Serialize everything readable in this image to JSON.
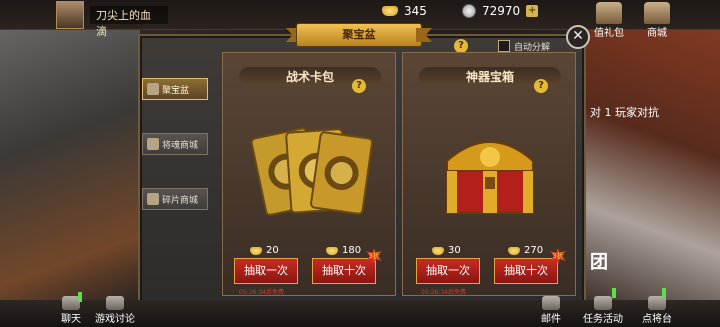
{
  "player": {
    "name": "刀尖上的血滴"
  },
  "resources": {
    "gold": "345",
    "silver": "72970",
    "gold_icon": "gold-ingot-icon",
    "silver_icon": "silver-coin-icon"
  },
  "top_menu": [
    {
      "label": "值礼包",
      "icon": "gift-icon"
    },
    {
      "label": "商城",
      "icon": "shop-icon"
    }
  ],
  "panel": {
    "title": "聚宝盆",
    "auto_decompose_label": "自动分解",
    "close_icon": "close-icon"
  },
  "side_tabs": [
    {
      "label": "聚宝盆",
      "active": true
    },
    {
      "label": "将魂商城",
      "active": false
    },
    {
      "label": "碎片商城",
      "active": false
    }
  ],
  "cards": [
    {
      "title": "战术卡包",
      "art": "tactic-card-pack",
      "single": {
        "price": "20",
        "label": "抽取一次"
      },
      "ten": {
        "price": "180",
        "label": "抽取十次",
        "badge": "9折"
      },
      "timer": "05:26:34后免费"
    },
    {
      "title": "神器宝箱",
      "art": "artifact-chest",
      "single": {
        "price": "30",
        "label": "抽取一次"
      },
      "ten": {
        "price": "270",
        "label": "抽取十次",
        "badge": "9折"
      },
      "timer": "05:26:34后免费"
    }
  ],
  "background_text": {
    "right_banner": "对 1 玩家对抗",
    "right_bottom": "团"
  },
  "bottom_menu": [
    {
      "label": "聊天",
      "icon": "chat-icon"
    },
    {
      "label": "游戏讨论",
      "icon": "discussion-icon"
    },
    {
      "label": "邮件",
      "icon": "mail-icon"
    },
    {
      "label": "任务活动",
      "icon": "task-icon"
    },
    {
      "label": "点将台",
      "icon": "generals-icon"
    }
  ],
  "colors": {
    "accent_gold": "#e4b936",
    "button_red": "#c62c22",
    "timer_red": "#d43a2f"
  }
}
